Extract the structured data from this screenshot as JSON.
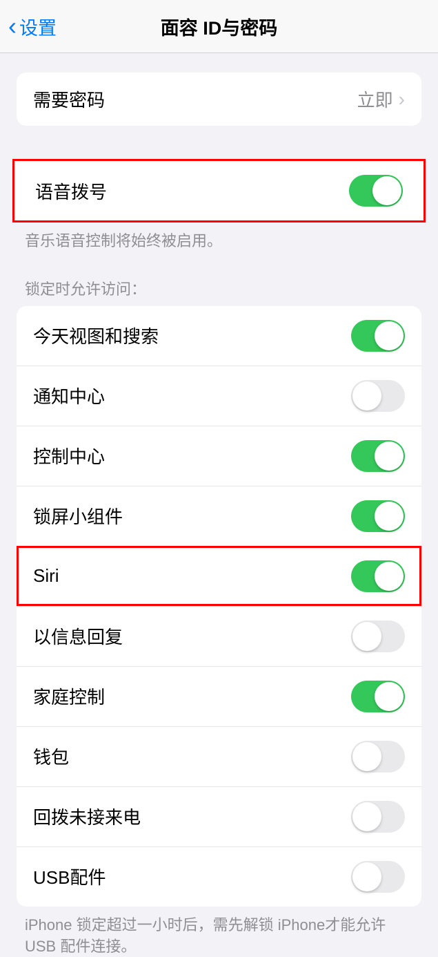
{
  "header": {
    "back_label": "设置",
    "title": "面容 ID与密码"
  },
  "passcode": {
    "label": "需要密码",
    "value": "立即"
  },
  "voice_dial": {
    "label": "语音拨号",
    "footer": "音乐语音控制将始终被启用。"
  },
  "locked_access": {
    "header": "锁定时允许访问：",
    "items": [
      {
        "label": "今天视图和搜索",
        "on": true
      },
      {
        "label": "通知中心",
        "on": false
      },
      {
        "label": "控制中心",
        "on": true
      },
      {
        "label": "锁屏小组件",
        "on": true
      },
      {
        "label": "Siri",
        "on": true
      },
      {
        "label": "以信息回复",
        "on": false
      },
      {
        "label": "家庭控制",
        "on": true
      },
      {
        "label": "钱包",
        "on": false
      },
      {
        "label": "回拨未接来电",
        "on": false
      },
      {
        "label": "USB配件",
        "on": false
      }
    ],
    "footer": "iPhone 锁定超过一小时后，需先解锁 iPhone才能允许USB 配件连接。"
  }
}
